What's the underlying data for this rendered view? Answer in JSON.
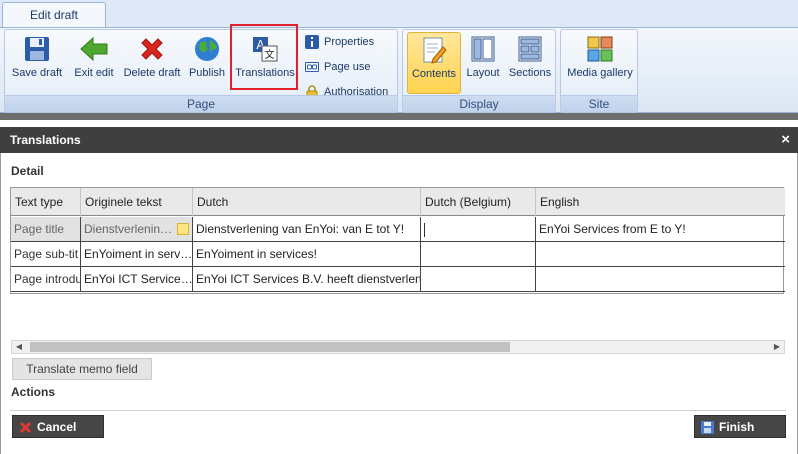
{
  "ribbon": {
    "tab_label": "Edit draft",
    "page_group": {
      "label": "Page",
      "buttons": [
        {
          "label": "Save draft",
          "icon": "save-icon"
        },
        {
          "label": "Exit edit",
          "icon": "exit-arrow-icon"
        },
        {
          "label": "Delete draft",
          "icon": "delete-x-icon"
        },
        {
          "label": "Publish",
          "icon": "globe-icon"
        },
        {
          "label": "Translations",
          "icon": "translate-icon"
        }
      ],
      "small_buttons": [
        {
          "label": "Properties",
          "icon": "info-icon"
        },
        {
          "label": "Page use",
          "icon": "link-icon"
        },
        {
          "label": "Authorisation",
          "icon": "lock-icon"
        }
      ]
    },
    "display_group": {
      "label": "Display",
      "buttons": [
        {
          "label": "Contents",
          "icon": "edit-page-icon",
          "active": true
        },
        {
          "label": "Layout",
          "icon": "layout-icon"
        },
        {
          "label": "Sections",
          "icon": "sections-icon"
        }
      ]
    },
    "site_group": {
      "label": "Site",
      "buttons": [
        {
          "label": "Media gallery",
          "icon": "media-gallery-icon"
        }
      ]
    }
  },
  "dialog": {
    "title": "Translations",
    "close_symbol": "×",
    "detail_label": "Detail",
    "actions_label": "Actions",
    "columns": [
      "Text type",
      "Originele tekst",
      "Dutch",
      "Dutch (Belgium)",
      "English"
    ],
    "rows": [
      {
        "type": "Page title",
        "original": "Dienstverlenin…",
        "dutch": "Dienstverlening van EnYoi: van E tot Y!",
        "dutch_be": "",
        "english": "EnYoi Services from E to Y!"
      },
      {
        "type": "Page sub-tit",
        "original": "EnYoiment in serv…",
        "dutch": "EnYoiment in services!",
        "dutch_be": "",
        "english": ""
      },
      {
        "type": "Page introdu",
        "original": "EnYoi ICT Service…",
        "dutch": "EnYoi ICT Services B.V. heeft dienstverlenin",
        "dutch_be": "",
        "english": ""
      }
    ],
    "translate_memo_label": "Translate memo field",
    "cancel_label": "Cancel",
    "finish_label": "Finish"
  }
}
